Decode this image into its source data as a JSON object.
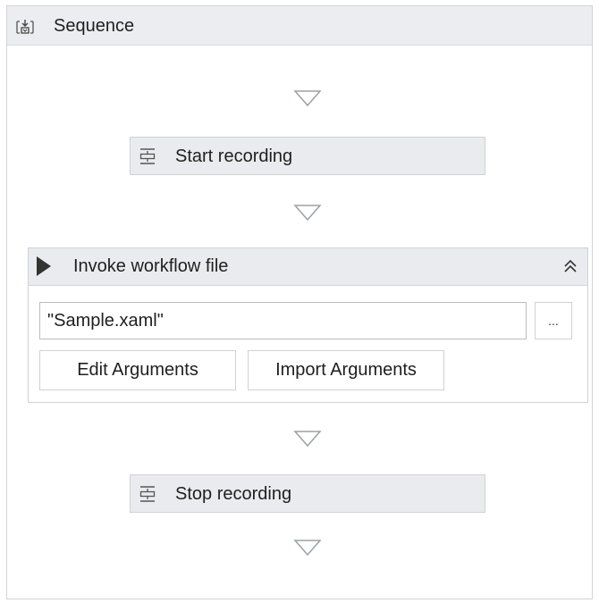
{
  "sequence": {
    "title": "Sequence",
    "icon": "sequence-icon"
  },
  "activities": {
    "start": {
      "label": "Start recording",
      "icon": "recording-icon"
    },
    "stop": {
      "label": "Stop recording",
      "icon": "recording-icon"
    }
  },
  "invoke": {
    "title": "Invoke workflow file",
    "icon": "play-icon",
    "collapse_icon": "double-chevron-up-icon",
    "file_value": "\"Sample.xaml\"",
    "browse_label": "...",
    "edit_arguments_label": "Edit Arguments",
    "import_arguments_label": "Import Arguments"
  },
  "colors": {
    "header_bg": "#ebedf0",
    "activity_bg": "#e9ebee",
    "border": "#cfd2d6",
    "arrow": "#9aa0a6"
  }
}
